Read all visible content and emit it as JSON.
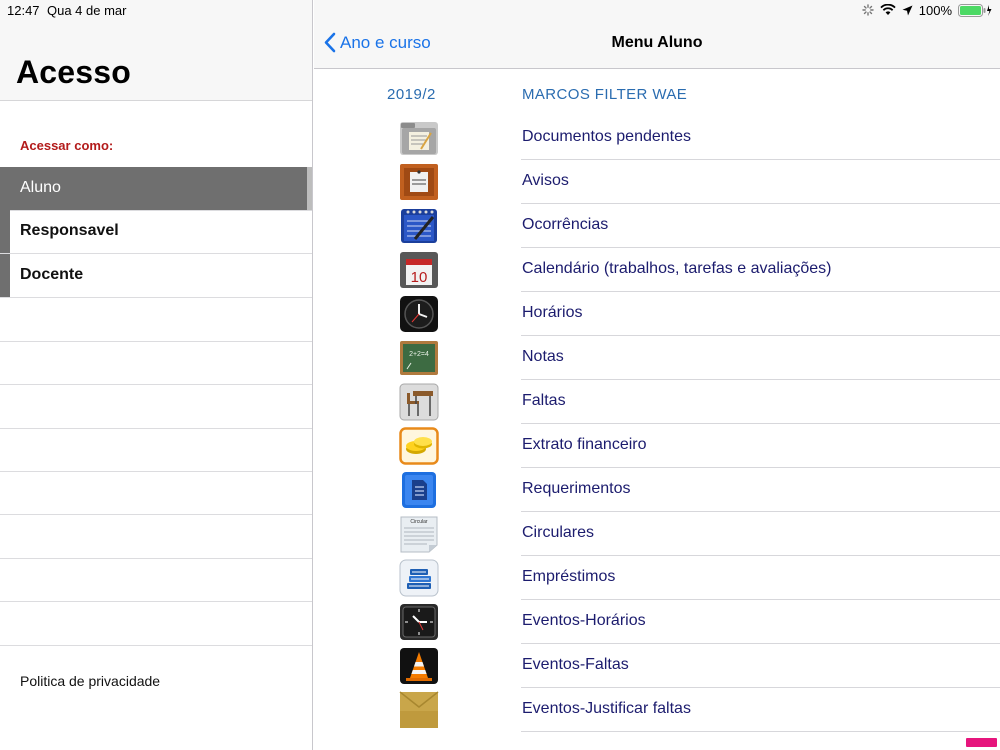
{
  "status": {
    "time": "12:47",
    "date": "Qua 4 de mar",
    "battery": "100%"
  },
  "sidebar": {
    "title": "Acesso",
    "section_label": "Acessar como:",
    "roles": [
      {
        "label": "Aluno",
        "selected": true
      },
      {
        "label": "Responsavel",
        "selected": false
      },
      {
        "label": "Docente",
        "selected": false
      }
    ],
    "privacy_link": "Politica de privacidade"
  },
  "navbar": {
    "back_label": "Ano e curso",
    "title": "Menu Aluno"
  },
  "student": {
    "year": "2019/2",
    "name": "MARCOS FILTER WAE"
  },
  "menu": [
    {
      "label": "Documentos pendentes",
      "icon": "folder-icon"
    },
    {
      "label": "Avisos",
      "icon": "notice-board-icon"
    },
    {
      "label": "Ocorrências",
      "icon": "notebook-pen-icon"
    },
    {
      "label": "Calendário (trabalhos, tarefas e avaliações)",
      "icon": "calendar-icon",
      "icon_text": "10"
    },
    {
      "label": "Horários",
      "icon": "clock-icon"
    },
    {
      "label": "Notas",
      "icon": "chalkboard-icon",
      "icon_text": "2+2=4"
    },
    {
      "label": "Faltas",
      "icon": "school-desk-icon"
    },
    {
      "label": "Extrato financeiro",
      "icon": "gold-coins-icon"
    },
    {
      "label": "Requerimentos",
      "icon": "document-icon"
    },
    {
      "label": "Circulares",
      "icon": "circular-paper-icon",
      "icon_text": "Circular"
    },
    {
      "label": "Empréstimos",
      "icon": "books-icon"
    },
    {
      "label": "Eventos-Horários",
      "icon": "wall-clock-icon"
    },
    {
      "label": "Eventos-Faltas",
      "icon": "traffic-cone-icon"
    },
    {
      "label": "Eventos-Justificar faltas",
      "icon": "envelope-icon"
    }
  ],
  "colors": {
    "link_blue": "#1a73e8",
    "info_blue": "#2a6cb0",
    "menu_text": "#1c1c6e",
    "section_red": "#b31b1b",
    "selected_row": "#6f6f6f"
  }
}
